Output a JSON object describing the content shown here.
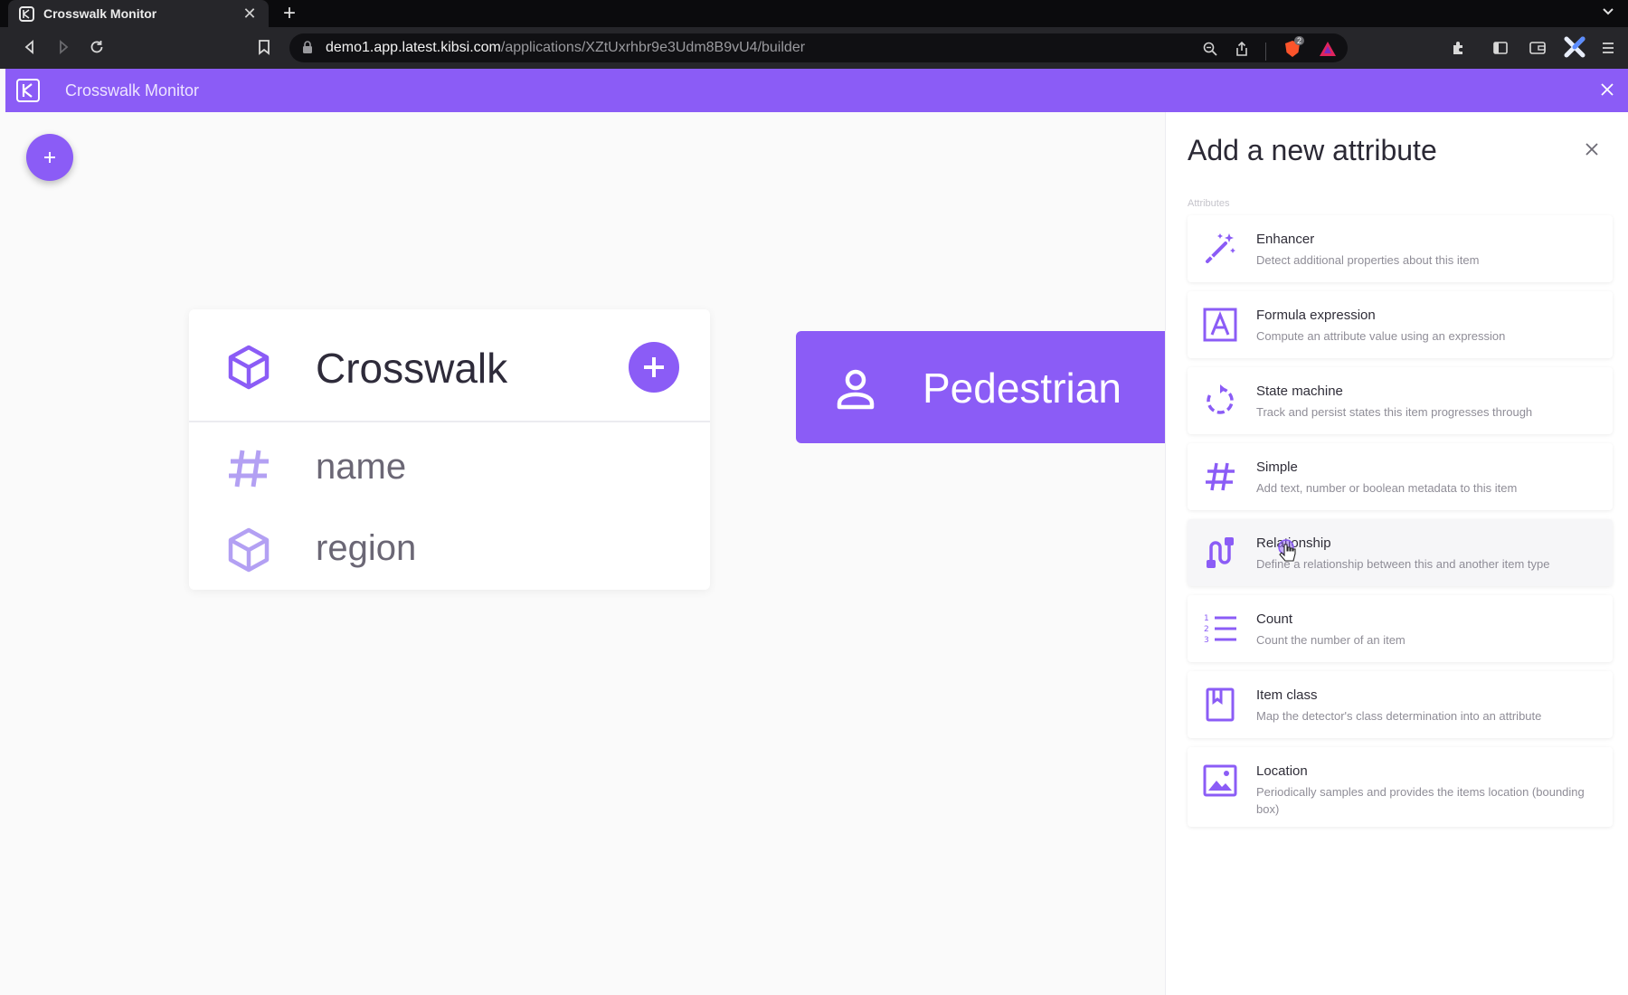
{
  "browser": {
    "tab_title": "Crosswalk Monitor",
    "address_host": "demo1.app.latest.kibsi.com",
    "address_path": "/applications/XZtUxrhbr9e3Udm8B9vU4/builder",
    "shield_badge": "2"
  },
  "app": {
    "title": "Crosswalk Monitor",
    "accent": "#8b5cf6"
  },
  "canvas": {
    "crosswalk": {
      "title": "Crosswalk",
      "attributes": [
        {
          "label": "name",
          "icon": "hash-icon"
        },
        {
          "label": "region",
          "icon": "cube-icon"
        }
      ]
    },
    "pedestrian": {
      "title": "Pedestrian",
      "icon": "person-icon"
    }
  },
  "panel": {
    "title": "Add a new attribute",
    "section_label": "Attributes",
    "options": [
      {
        "title": "Enhancer",
        "desc": "Detect additional properties about this item",
        "icon": "magic-wand-icon"
      },
      {
        "title": "Formula expression",
        "desc": "Compute an attribute value using an expression",
        "icon": "formula-icon"
      },
      {
        "title": "State machine",
        "desc": "Track and persist states this item progresses through",
        "icon": "state-cycle-icon"
      },
      {
        "title": "Simple",
        "desc": "Add text, number or boolean metadata to this item",
        "icon": "hash-icon"
      },
      {
        "title": "Relationship",
        "desc": "Define a relationship between this and another item type",
        "icon": "relationship-icon"
      },
      {
        "title": "Count",
        "desc": "Count the number of an item",
        "icon": "numbered-list-icon"
      },
      {
        "title": "Item class",
        "desc": "Map the detector's class determination into an attribute",
        "icon": "bookmark-icon"
      },
      {
        "title": "Location",
        "desc": "Periodically samples and provides the items location (bounding box)",
        "icon": "image-location-icon"
      }
    ]
  }
}
